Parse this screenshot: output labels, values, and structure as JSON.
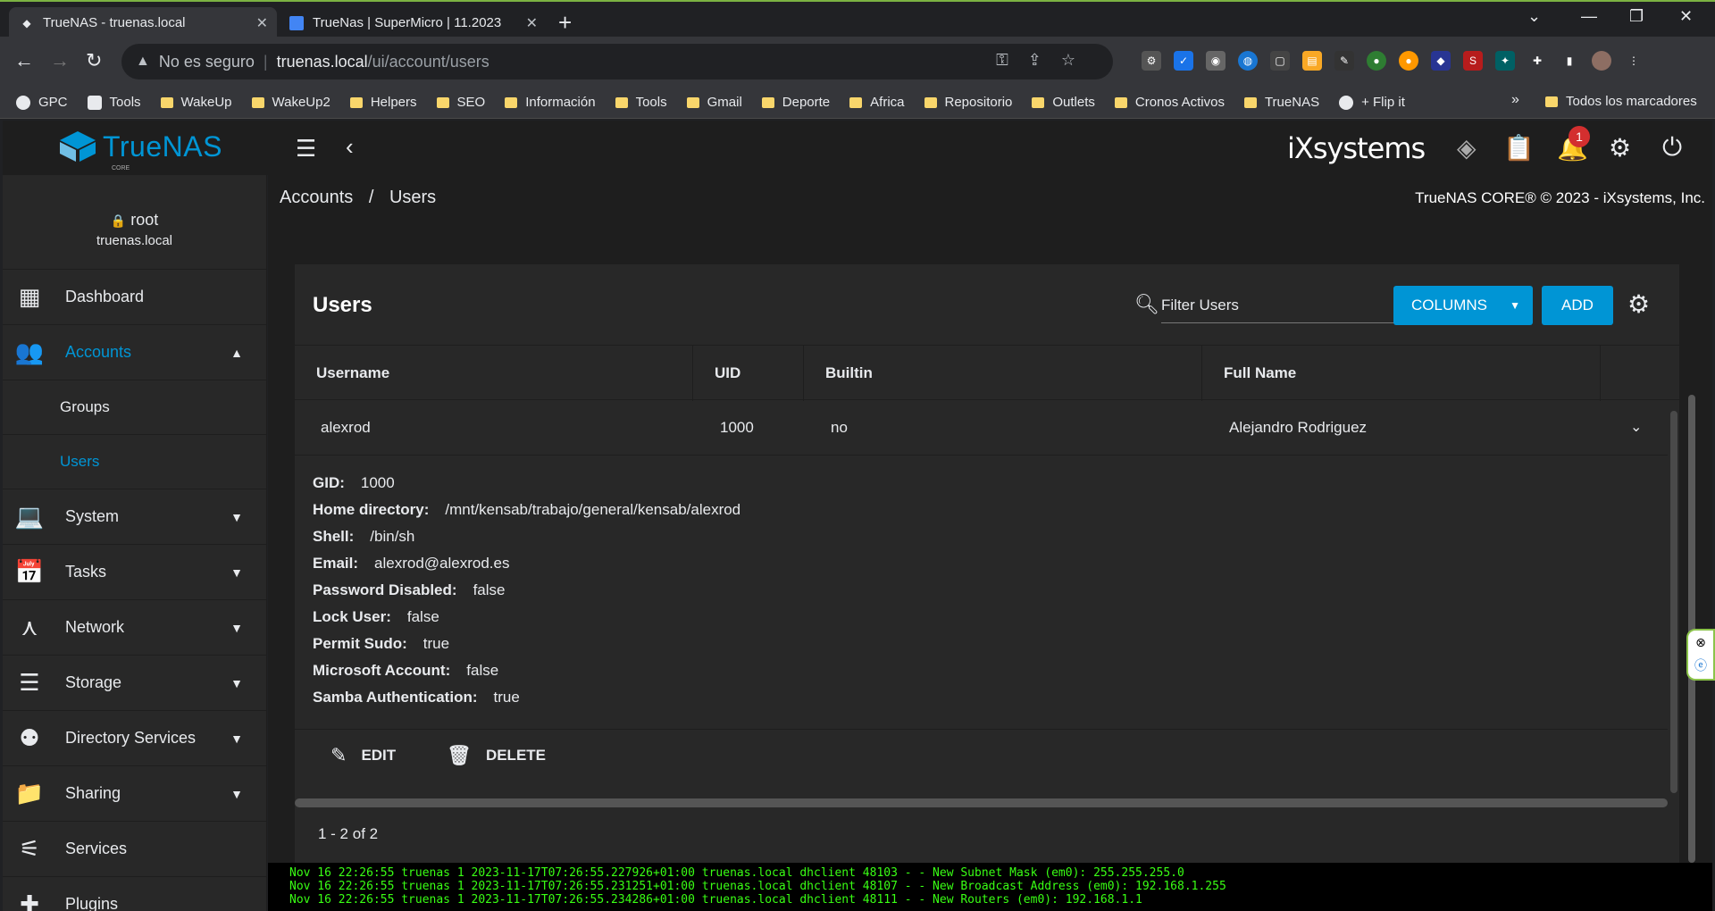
{
  "browser": {
    "tabs": [
      {
        "title": "TrueNAS - truenas.local",
        "active": true
      },
      {
        "title": "TrueNas | SuperMicro | 11.2023",
        "active": false
      }
    ],
    "url_warning": "No es seguro",
    "url_host": "truenas.local",
    "url_path": "/ui/account/users",
    "bookmarks": [
      "GPC",
      "Tools",
      "WakeUp",
      "WakeUp2",
      "Helpers",
      "SEO",
      "Información",
      "Tools",
      "Gmail",
      "Deporte",
      "Africa",
      "Repositorio",
      "Outlets",
      "Cronos Activos",
      "TrueNAS",
      "+ Flip it"
    ],
    "bookmarks_more": "»",
    "all_bookmarks": "Todos los marcadores"
  },
  "header": {
    "logo_text": "TrueNAS",
    "logo_sub": "CORE",
    "brand": "iXsystems",
    "notification_count": "1"
  },
  "sidebar": {
    "username": "root",
    "hostname": "truenas.local",
    "items": [
      {
        "label": "Dashboard",
        "icon": "dashboard-icon"
      },
      {
        "label": "Accounts",
        "icon": "people-icon",
        "active": true
      },
      {
        "label": "System",
        "icon": "laptop-icon"
      },
      {
        "label": "Tasks",
        "icon": "calendar-icon"
      },
      {
        "label": "Network",
        "icon": "network-icon"
      },
      {
        "label": "Storage",
        "icon": "storage-icon"
      },
      {
        "label": "Directory Services",
        "icon": "directory-icon"
      },
      {
        "label": "Sharing",
        "icon": "folder-shared-icon"
      },
      {
        "label": "Services",
        "icon": "tune-icon"
      },
      {
        "label": "Plugins",
        "icon": "plugin-icon"
      }
    ],
    "subitems": [
      {
        "label": "Groups"
      },
      {
        "label": "Users",
        "selected": true
      }
    ]
  },
  "breadcrumb": {
    "parent": "Accounts",
    "separator": "/",
    "current": "Users"
  },
  "copyright": "TrueNAS CORE® © 2023 - iXsystems, Inc.",
  "users": {
    "title": "Users",
    "filter_placeholder": "Filter Users",
    "columns_label": "COLUMNS",
    "add_label": "ADD",
    "headers": [
      "Username",
      "UID",
      "Builtin",
      "Full Name"
    ],
    "row": {
      "username": "alexrod",
      "uid": "1000",
      "builtin": "no",
      "fullname": "Alejandro Rodriguez"
    },
    "details": [
      {
        "key": "GID:",
        "value": "1000"
      },
      {
        "key": "Home directory:",
        "value": "/mnt/kensab/trabajo/general/kensab/alexrod"
      },
      {
        "key": "Shell:",
        "value": "/bin/sh"
      },
      {
        "key": "Email:",
        "value": "alexrod@alexrod.es"
      },
      {
        "key": "Password Disabled:",
        "value": "false"
      },
      {
        "key": "Lock User:",
        "value": "false"
      },
      {
        "key": "Permit Sudo:",
        "value": "true"
      },
      {
        "key": "Microsoft Account:",
        "value": "false"
      },
      {
        "key": "Samba Authentication:",
        "value": "true"
      }
    ],
    "edit_label": "EDIT",
    "delete_label": "DELETE",
    "pager": "1 - 2 of 2"
  },
  "console": {
    "lines": [
      "Nov 16 22:26:55 truenas 1 2023-11-17T07:26:55.227926+01:00 truenas.local dhclient 48103 - - New Subnet Mask (em0): 255.255.255.0",
      "Nov 16 22:26:55 truenas 1 2023-11-17T07:26:55.231251+01:00 truenas.local dhclient 48107 - - New Broadcast Address (em0): 192.168.1.255",
      "Nov 16 22:26:55 truenas 1 2023-11-17T07:26:55.234286+01:00 truenas.local dhclient 48111 - - New Routers (em0): 192.168.1.1"
    ]
  },
  "colors": {
    "accent": "#0095d5",
    "console_text": "#39ff14",
    "badge": "#d32f2f"
  }
}
